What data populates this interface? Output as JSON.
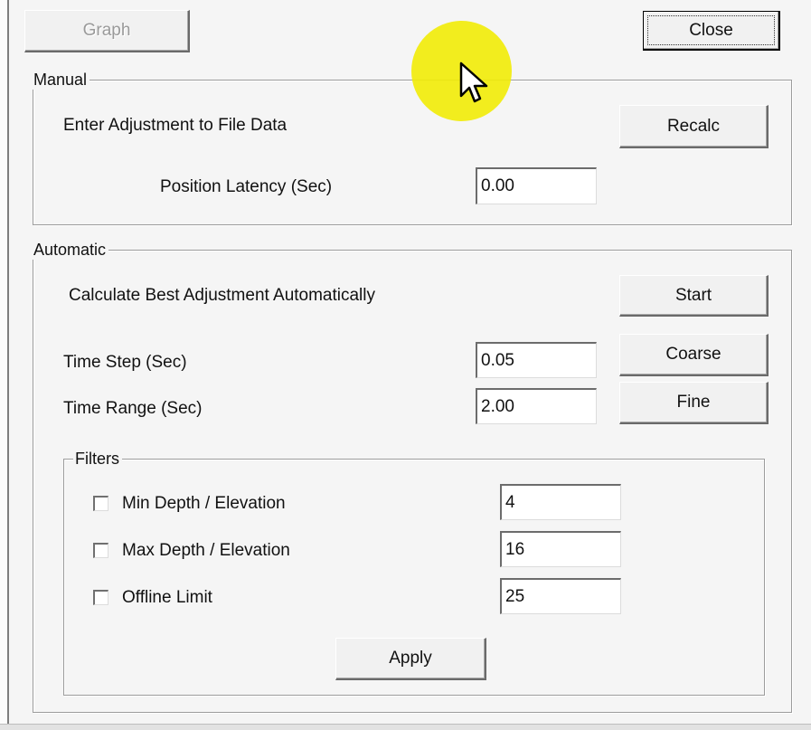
{
  "toolbar": {
    "graph_label": "Graph",
    "close_label": "Close"
  },
  "manual": {
    "title": "Manual",
    "instruction": "Enter Adjustment to File Data",
    "recalc_label": "Recalc",
    "latency_label": "Position Latency (Sec)",
    "latency_value": "0.00"
  },
  "automatic": {
    "title": "Automatic",
    "instruction": "Calculate Best Adjustment Automatically",
    "start_label": "Start",
    "time_step_label": "Time Step (Sec)",
    "time_step_value": "0.05",
    "coarse_label": "Coarse",
    "time_range_label": "Time Range (Sec)",
    "time_range_value": "2.00",
    "fine_label": "Fine"
  },
  "filters": {
    "title": "Filters",
    "items": [
      {
        "label": "Min Depth / Elevation",
        "value": "4",
        "checked": false
      },
      {
        "label": "Max Depth / Elevation",
        "value": "16",
        "checked": false
      },
      {
        "label": "Offline Limit",
        "value": "25",
        "checked": false
      }
    ],
    "apply_label": "Apply"
  },
  "overlay": {
    "highlight_color": "#f1ec0b",
    "cursor_icon": "mouse-pointer-icon"
  }
}
